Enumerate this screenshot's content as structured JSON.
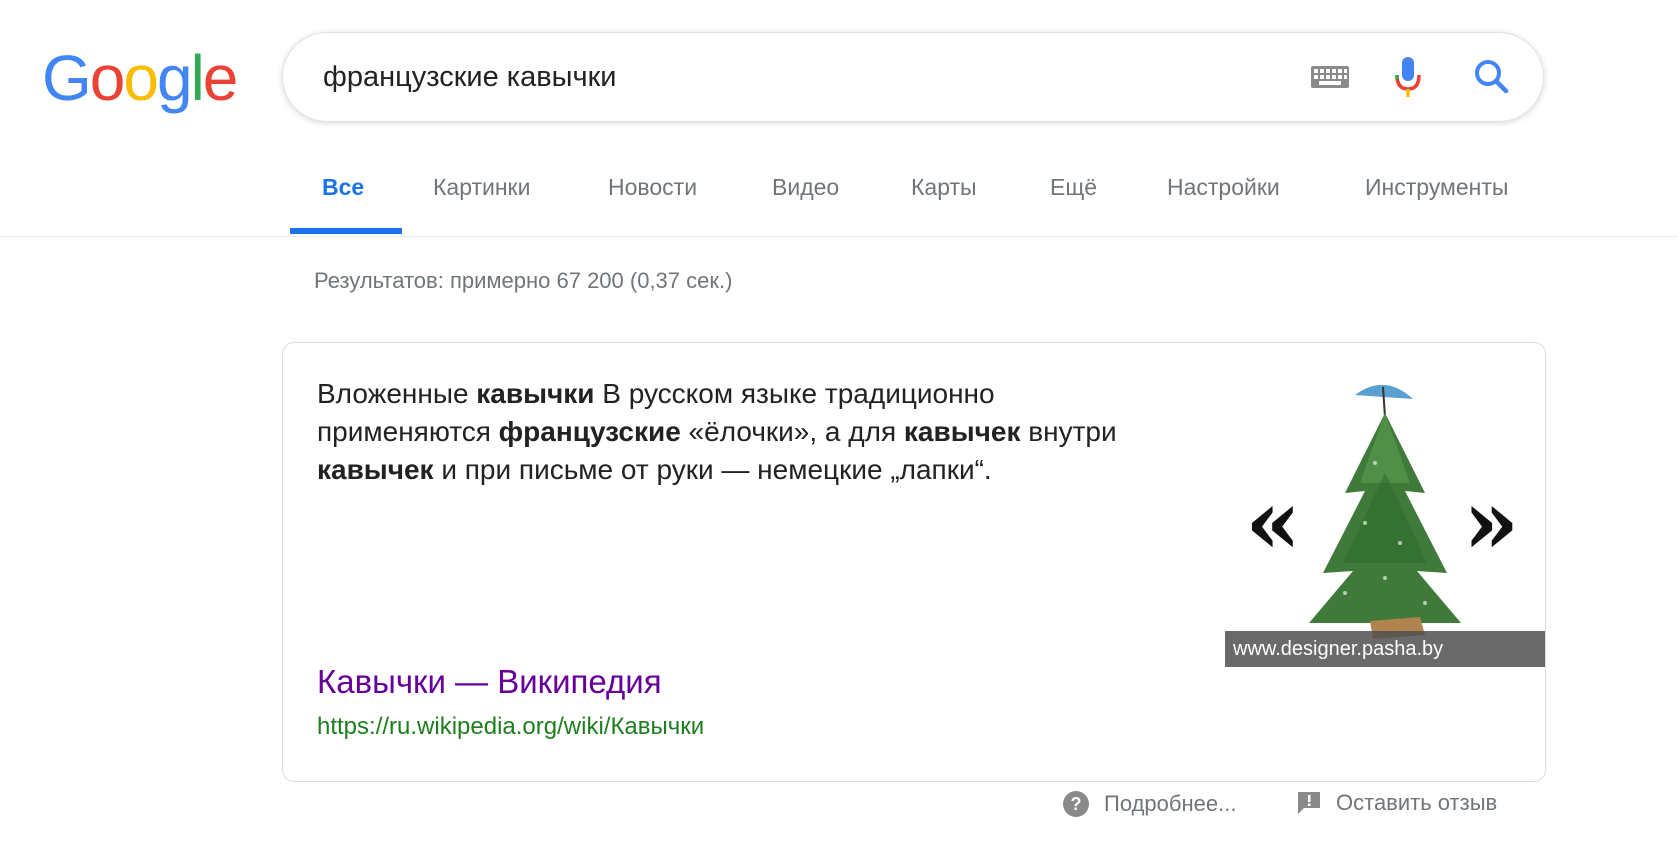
{
  "logo": {
    "letters": [
      "G",
      "o",
      "o",
      "g",
      "l",
      "e"
    ],
    "colors": [
      "#4285F4",
      "#EA4335",
      "#FBBC05",
      "#4285F4",
      "#34A853",
      "#EA4335"
    ]
  },
  "search": {
    "query": "французские кавычки",
    "keyboard_icon": "keyboard-icon",
    "mic_icon": "microphone-icon",
    "search_icon": "search-icon"
  },
  "tabs": [
    "Все",
    "Картинки",
    "Новости",
    "Видео",
    "Карты",
    "Ещё",
    "Настройки",
    "Инструменты"
  ],
  "results_stats": "Результатов: примерно 67 200 (0,37 сек.)",
  "featured": {
    "snippet": [
      {
        "t": "Вложенные ",
        "b": false
      },
      {
        "t": "кавычки",
        "b": true
      },
      {
        "t": " В русском языке традиционно применяются ",
        "b": false
      },
      {
        "t": "французские",
        "b": true
      },
      {
        "t": " «ёлочки», а для ",
        "b": false
      },
      {
        "t": "кавычек",
        "b": true
      },
      {
        "t": " внутри ",
        "b": false
      },
      {
        "t": "кавычек",
        "b": true
      },
      {
        "t": " и при письме от руки — немецкие „лапки“.",
        "b": false
      }
    ],
    "title": "Кавычки — Википедия",
    "url": "https://ru.wikipedia.org/wiki/Кавычки",
    "image_caption": "www.designer.pasha.by",
    "image_left_glyph": "«",
    "image_right_glyph": "»"
  },
  "footer": {
    "more": "Подробнее...",
    "feedback": "Оставить отзыв"
  },
  "colors": {
    "accent": "#1a73e8",
    "visited_link": "#660099",
    "url_green": "#1e7e1e",
    "muted": "#70757a"
  }
}
